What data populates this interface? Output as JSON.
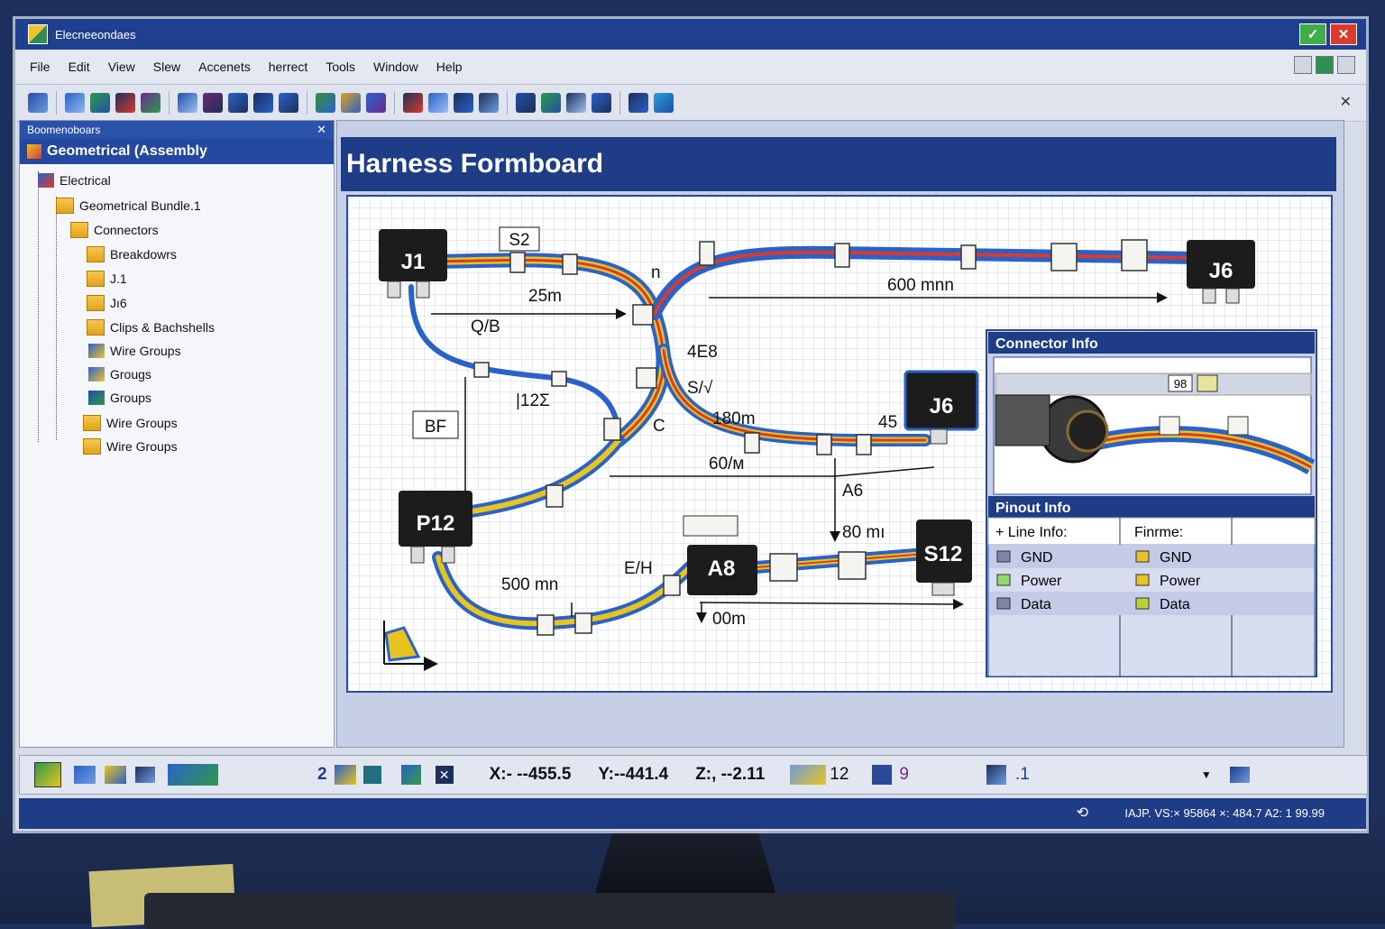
{
  "window": {
    "title": "Elecneeondaes"
  },
  "menu": [
    "File",
    "Edit",
    "View",
    "Slew",
    "Accenets",
    "herrect",
    "Tools",
    "Window",
    "Help"
  ],
  "tree": {
    "panel_title": "Boomenoboars",
    "root": "Geometrical (Assembly",
    "items": [
      {
        "label": "Electrical"
      },
      {
        "label": "Geometrical Bundle.1"
      },
      {
        "label": "Connectors"
      },
      {
        "label": "Breakdowrs"
      },
      {
        "label": "J.1"
      },
      {
        "label": "Jı6"
      },
      {
        "label": "Clips & Bachshells"
      },
      {
        "label": "Wire Groups"
      },
      {
        "label": "Grougs"
      },
      {
        "label": "Groups"
      },
      {
        "label": "Wire Groups"
      },
      {
        "label": "Wire Groups"
      }
    ]
  },
  "main": {
    "title": "Harness Formboard",
    "connectors": {
      "j1": "J1",
      "j6_top": "J6",
      "j6_mid": "J6",
      "p12": "P12",
      "a8": "A8",
      "s12": "S12"
    },
    "labels": {
      "s2": "S2",
      "l25": "25m",
      "qb": "Q/B",
      "n": "n",
      "l600": "600 mnn",
      "e8": "4E8",
      "s": "S/√",
      "l12": "|12Σ",
      "bf": "BF",
      "l180": "180m",
      "l45": "45",
      "l60": "60/м",
      "a6": "A6",
      "l80": "80 mı",
      "eh": "E/H",
      "l500": "500 mn",
      "l00": "00m",
      "c": "C"
    },
    "connector_info": {
      "title": "Connector Info",
      "badge": "98"
    },
    "pinout": {
      "title": "Pinout Info",
      "col1": "+ Line Info:",
      "col2": "Finrme:",
      "rows_left": [
        "GND",
        "Power",
        "Data"
      ],
      "rows_right": [
        "GND",
        "Power",
        "Data"
      ],
      "colors_left": [
        "#7c86a8",
        "#8fdc6c",
        "#7c86a8"
      ],
      "colors_right": [
        "#e8c22a",
        "#e8c22a",
        "#b9d43a"
      ]
    }
  },
  "status": {
    "num": "2",
    "x": "X:- --455.5",
    "y": "Y:--441.4",
    "z": "Z:, --2.11",
    "count": "12",
    "nine": "9",
    "one": ".1"
  },
  "bottom": {
    "text": "IAJP. VS:× 95864 ×: 484.7 A2: 1 99.99"
  }
}
